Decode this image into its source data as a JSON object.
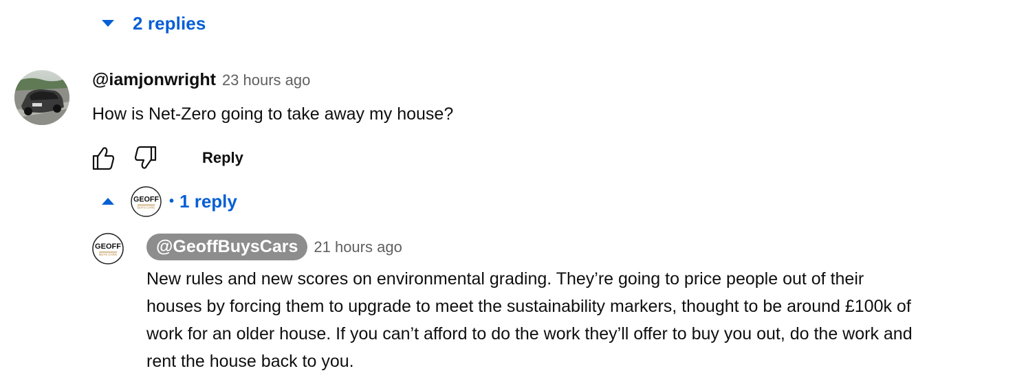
{
  "thread": {
    "replies_toggle_label": "2 replies"
  },
  "comment": {
    "author": "@iamjonwright",
    "time": "23 hours ago",
    "text": "How is Net-Zero going to take away my house?",
    "avatar_icon": "car-photo-avatar",
    "actions": {
      "like_icon": "thumbs-up-icon",
      "dislike_icon": "thumbs-down-icon",
      "reply_label": "Reply"
    }
  },
  "reply_toggle": {
    "dot": "•",
    "label": "1 reply",
    "avatar_logo": {
      "line1": "GEOFF",
      "line2": "BUYS CARS"
    }
  },
  "reply": {
    "author": "@GeoffBuysCars",
    "time": "21 hours ago",
    "avatar_logo": {
      "line1": "GEOFF",
      "line2": "BUYS CARS"
    },
    "lines": [
      "New rules and new scores on environmental grading. They’re going to price people out of their",
      "houses by forcing them to upgrade to meet the sustainability markers, thought to be around £100k of",
      "work for an older house. If you can’t afford to do the work they’ll offer to buy you out, do the work and",
      "rent the house back to you."
    ]
  },
  "colors": {
    "link_blue": "#065fd4",
    "creator_chip": "#8d8d8d",
    "meta_gray": "#606060",
    "text": "#0f0f0f"
  }
}
